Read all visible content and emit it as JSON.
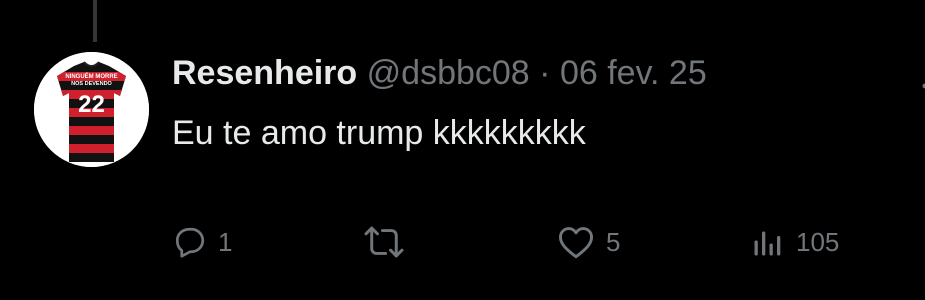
{
  "tweet": {
    "display_name": "Resenheiro",
    "handle": "@dsbbc08",
    "separator": "·",
    "date": "06 fev. 25",
    "text": "Eu te amo trump kkkkkkkkk",
    "avatar_text": {
      "line1": "NINGUÉM MORRE",
      "line2": "NOS DEVENDO",
      "number": "22"
    }
  },
  "actions": {
    "reply_count": "1",
    "retweet_count": "",
    "like_count": "5",
    "views_count": "105"
  },
  "icons": {
    "reply": "reply-icon",
    "retweet": "retweet-icon",
    "like": "heart-icon",
    "views": "views-icon",
    "more": "more-icon"
  },
  "colors": {
    "background": "#000000",
    "primary_text": "#e7e9ea",
    "secondary_text": "#71767b",
    "jersey_red": "#d0202e",
    "jersey_black": "#111111"
  }
}
